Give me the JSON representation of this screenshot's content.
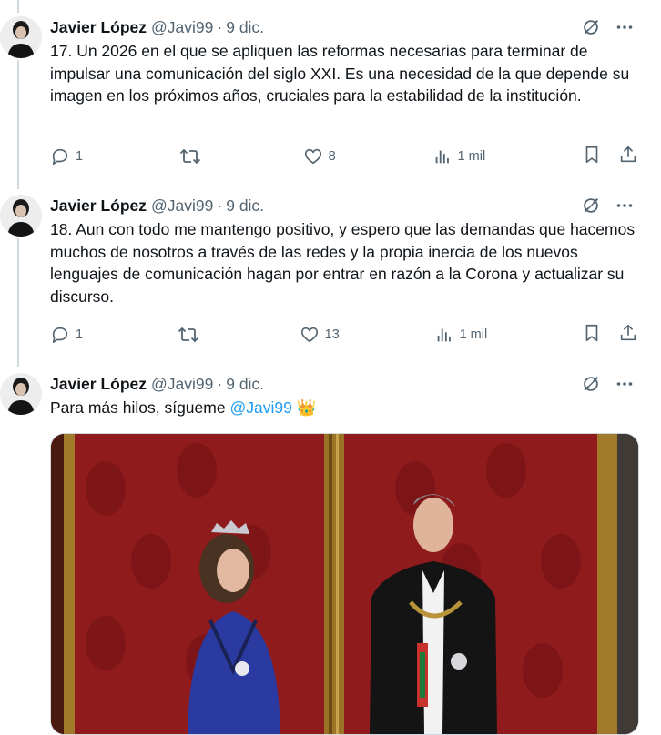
{
  "tweets": [
    {
      "author_name": "Javier López",
      "author_handle": "@Javi99",
      "separator": "·",
      "date": "9 dic.",
      "text": "17. Un 2026 en el que se apliquen las reformas necesarias para terminar de impulsar una comunicación del siglo XXI. Es una necesidad de la que depende su imagen en los próximos años, cruciales para la estabilidad de la institución.",
      "replies": "1",
      "retweets": "",
      "likes": "8",
      "views": "1 mil"
    },
    {
      "author_name": "Javier López",
      "author_handle": "@Javi99",
      "separator": "·",
      "date": "9 dic.",
      "text": "18. Aun con todo me mantengo positivo, y espero que las demandas que hacemos muchos de nosotros a través de las redes y la propia inercia de los nuevos lenguajes de comunicación hagan por entrar en razón a la Corona y actualizar su discurso.",
      "replies": "1",
      "retweets": "",
      "likes": "13",
      "views": "1 mil"
    },
    {
      "author_name": "Javier López",
      "author_handle": "@Javi99",
      "separator": "·",
      "date": "9 dic.",
      "text_before": "Para más hilos, sígueme ",
      "mention": "@Javi99",
      "emoji": "👑"
    }
  ],
  "icons": {
    "grok": "grok-icon",
    "more": "more-icon",
    "reply": "reply-icon",
    "retweet": "retweet-icon",
    "like": "heart-icon",
    "views": "views-icon",
    "bookmark": "bookmark-icon",
    "share": "share-icon"
  },
  "colors": {
    "text": "#0f1419",
    "secondary": "#536471",
    "link": "#1d9bf0",
    "thread_line": "#cfd9de"
  }
}
